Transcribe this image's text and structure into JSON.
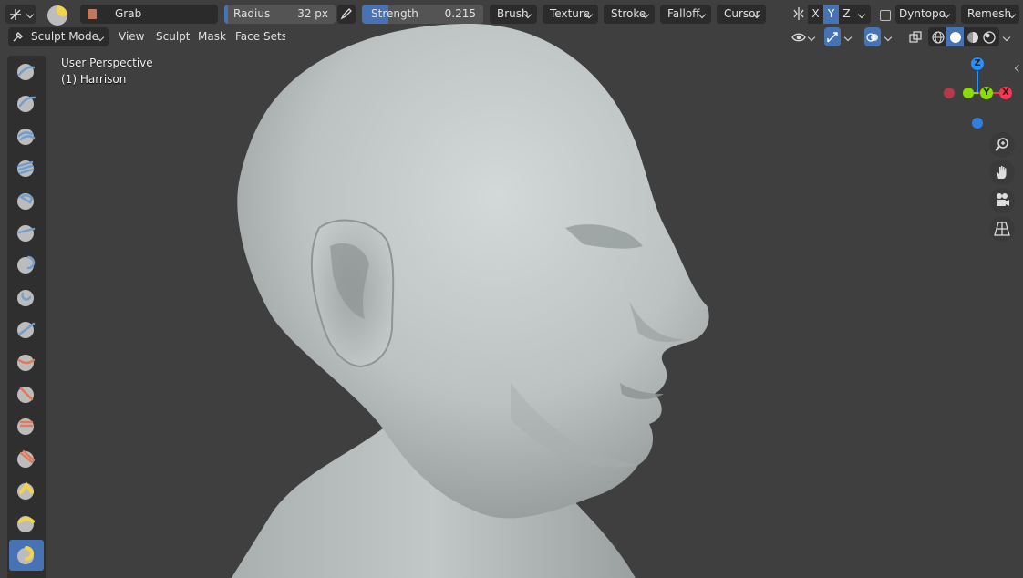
{
  "header": {
    "brush_name": "Grab",
    "radius_label": "Radius",
    "radius_value": "32 px",
    "strength_label": "Strength",
    "strength_value": "0.215",
    "strength_fraction": 0.215,
    "menus": [
      "Brush",
      "Texture",
      "Stroke",
      "Falloff",
      "Cursor"
    ],
    "axis_x": "X",
    "axis_y": "Y",
    "axis_z": "Z",
    "dyntopo_label": "Dyntopo",
    "remesh_label": "Remesh"
  },
  "header2": {
    "mode_label": "Sculpt Mode",
    "view_menu": "View",
    "sculpt_menu": "Sculpt",
    "mask_menu": "Mask",
    "facesets_menu": "Face Sets"
  },
  "viewport": {
    "perspective_label": "User Perspective",
    "object_label": "(1) Harrison"
  },
  "gizmo": {
    "z_label": "Z",
    "y_label": "Y",
    "x_label": "X",
    "colors": {
      "x": "#ff3352",
      "y": "#8bdc00",
      "z": "#2890ff"
    }
  },
  "toolbar": {
    "tools": [
      "draw-icon",
      "draw-sharp-icon",
      "clay-icon",
      "clay-strips-icon",
      "clay-thumb-icon",
      "layer-icon",
      "inflate-icon",
      "blob-icon",
      "crease-icon",
      "smooth-icon",
      "flatten-icon",
      "fill-icon",
      "scrape-icon",
      "multiplane-scrape-icon",
      "pinch-icon",
      "grab-icon",
      "elastic-deform-icon"
    ],
    "active_index": 15
  },
  "colors": {
    "accent": "#4772b3",
    "viewport_bg": "#3f3f3f",
    "widget_bg": "#2b2b2b"
  }
}
